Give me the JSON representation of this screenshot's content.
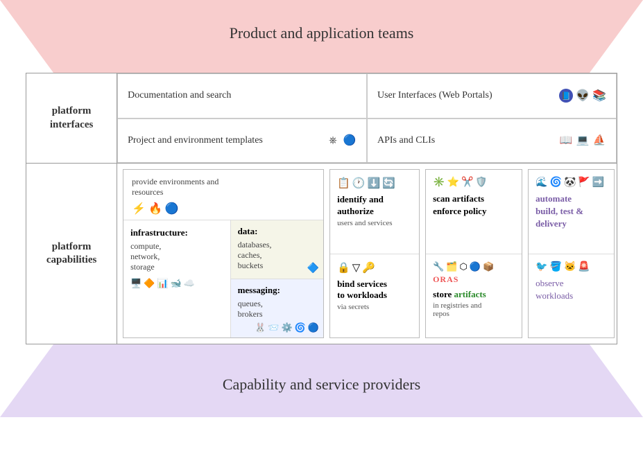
{
  "top_banner": {
    "label": "Product and application teams"
  },
  "bottom_banner": {
    "label": "Capability and service providers"
  },
  "platform_interfaces": {
    "label": "platform\ninterfaces",
    "cells": {
      "doc_search": "Documentation and search",
      "user_interfaces": "User Interfaces (Web Portals)",
      "project_env": "Project and environment templates",
      "apis_clis": "APIs and CLIs"
    }
  },
  "platform_capabilities": {
    "label": "platform\ncapabilities",
    "provide_label": "provide environments and\nresources",
    "infra_title": "infrastructure:",
    "infra_desc": "compute,\nnetwork,\nstorage",
    "data_title": "data:",
    "data_desc": "databases,\ncaches,\nbuckets",
    "messaging_title": "messaging:",
    "messaging_desc": "queues,\nbrokers",
    "identify_title": "identify and\nauthorize",
    "identify_subtitle": "users and services",
    "bind_title": "bind services\nto workloads",
    "bind_subtitle": "via secrets",
    "scan_title": "scan artifacts\nenforce policy",
    "store_title": "store",
    "store_artifacts": "artifacts",
    "store_desc": "in registries and\nrepos",
    "automate_title": "automate\nbuild, test &\ndelivery",
    "observe_title": "observe\nworkloads"
  }
}
